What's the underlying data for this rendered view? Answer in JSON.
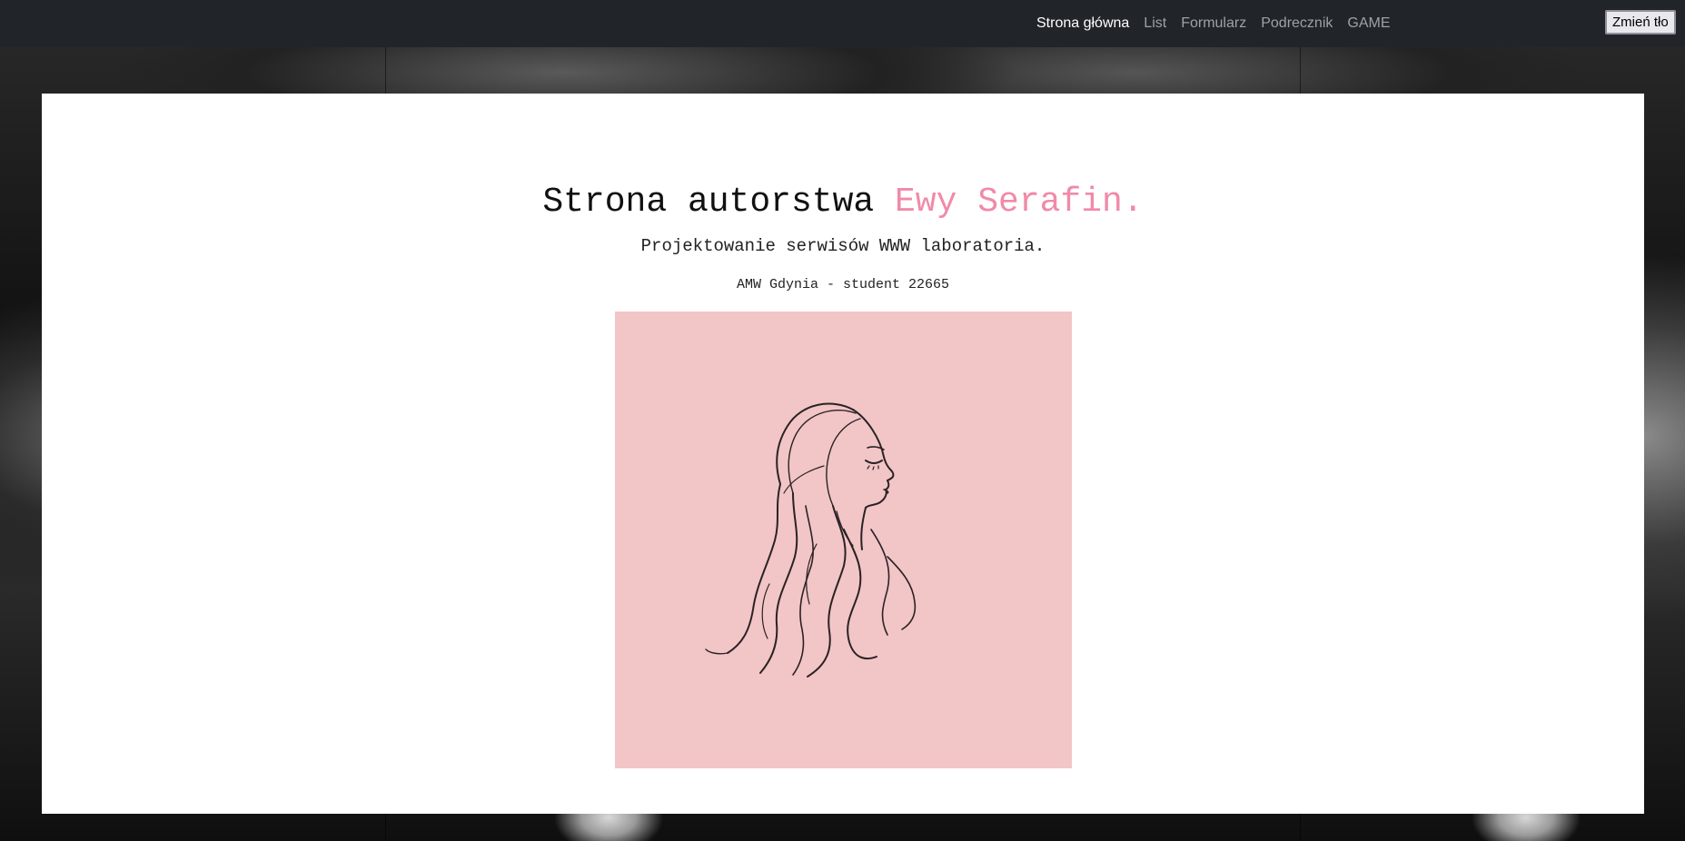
{
  "nav": {
    "items": [
      {
        "label": "Strona główna",
        "active": true
      },
      {
        "label": "List",
        "active": false
      },
      {
        "label": "Formularz",
        "active": false
      },
      {
        "label": "Podrecznik",
        "active": false
      },
      {
        "label": "GAME",
        "active": false
      }
    ],
    "change_bg_label": "Zmień tło"
  },
  "header": {
    "title_prefix": "Strona autorstwa ",
    "title_name": "Ewy Serafin.",
    "subtitle": "Projektowanie serwisów WWW laboratoria.",
    "student_line": "AMW Gdynia - student 22665"
  },
  "colors": {
    "navbar": "#212529",
    "accent": "#f08aa8",
    "portrait_bg": "#f2c5c7"
  },
  "icons": {
    "portrait": "woman-line-drawing"
  }
}
